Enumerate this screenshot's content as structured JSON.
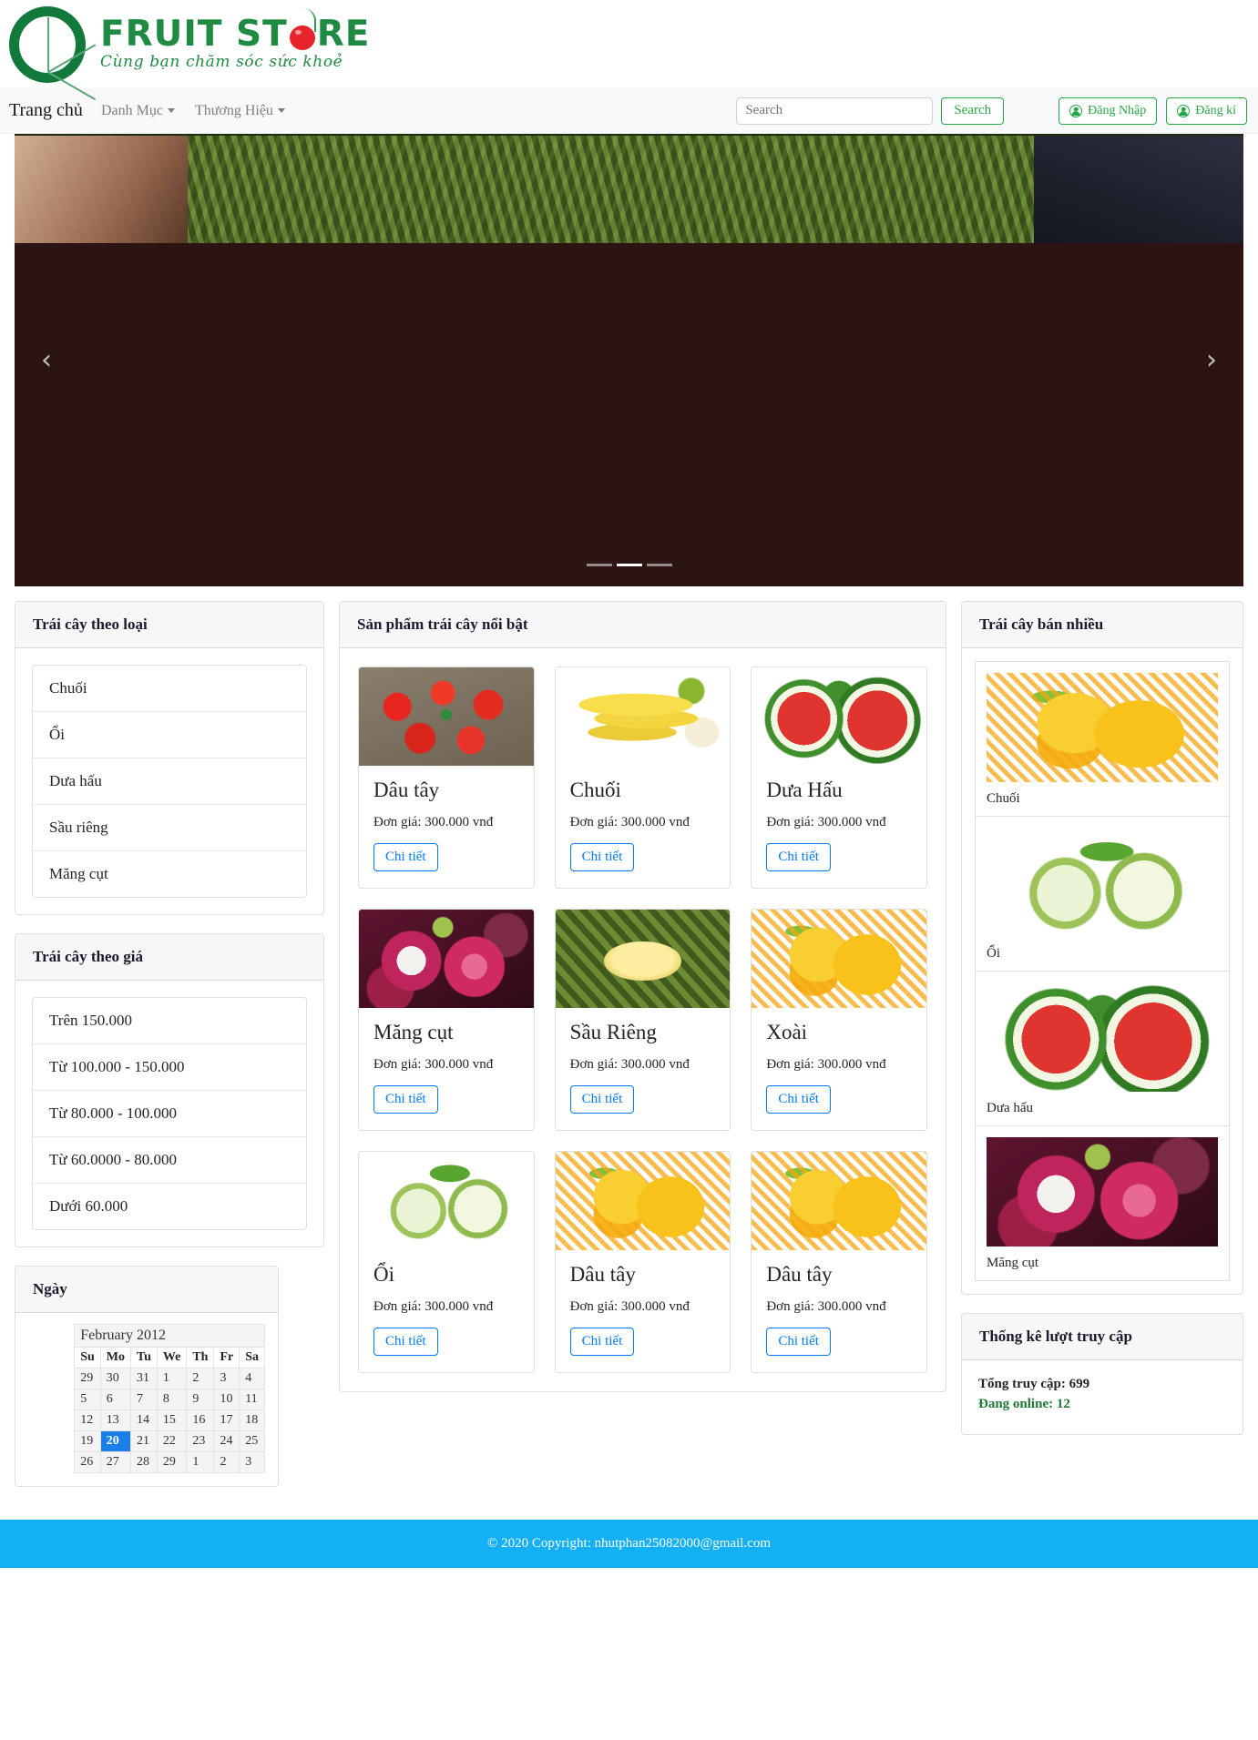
{
  "brand": {
    "name_part1": "FRUIT ST",
    "name_part2": "RE",
    "tagline": "Cùng bạn chăm sóc sức khoẻ"
  },
  "nav": {
    "home": "Trang chủ",
    "items": [
      {
        "label": "Danh Mục",
        "icon": "chevron-down-icon"
      },
      {
        "label": "Thương Hiệu",
        "icon": "chevron-down-icon"
      }
    ],
    "search": {
      "placeholder": "Search",
      "value": "",
      "button": "Search"
    },
    "login": "Đăng Nhập",
    "register": "Đăng kí"
  },
  "carousel": {
    "prev": "‹",
    "next": "›",
    "slides": 3,
    "active_index": 1
  },
  "categories": {
    "title": "Trái cây theo loại",
    "items": [
      "Chuối",
      "Ổi",
      "Dưa hấu",
      "Sầu riêng",
      "Măng cụt"
    ]
  },
  "prices": {
    "title": "Trái cây theo giá",
    "items": [
      "Trên 150.000",
      "Từ 100.000 - 150.000",
      "Từ 80.000 - 100.000",
      "Từ 60.0000 - 80.000",
      "Dưới 60.000"
    ]
  },
  "calendar": {
    "title": "Ngày",
    "month_label": "February 2012",
    "weekdays": [
      "Su",
      "Mo",
      "Tu",
      "We",
      "Th",
      "Fr",
      "Sa"
    ],
    "weeks": [
      [
        "29",
        "30",
        "31",
        "1",
        "2",
        "3",
        "4"
      ],
      [
        "5",
        "6",
        "7",
        "8",
        "9",
        "10",
        "11"
      ],
      [
        "12",
        "13",
        "14",
        "15",
        "16",
        "17",
        "18"
      ],
      [
        "19",
        "20",
        "21",
        "22",
        "23",
        "24",
        "25"
      ],
      [
        "26",
        "27",
        "28",
        "29",
        "1",
        "2",
        "3"
      ]
    ],
    "selected_day": "20"
  },
  "featured": {
    "title": "Sản phẩm trái cây nổi bật",
    "detail_label": "Chi tiết",
    "products": [
      {
        "name": "Dâu tây",
        "price": "Đơn giá: 300.000 vnđ",
        "image": "strawberry"
      },
      {
        "name": "Chuối",
        "price": "Đơn giá: 300.000 vnđ",
        "image": "banana"
      },
      {
        "name": "Dưa Hấu",
        "price": "Đơn giá: 300.000 vnđ",
        "image": "watermelon"
      },
      {
        "name": "Măng cụt",
        "price": "Đơn giá: 300.000 vnđ",
        "image": "mangosteen"
      },
      {
        "name": "Sầu Riêng",
        "price": "Đơn giá: 300.000 vnđ",
        "image": "durian"
      },
      {
        "name": "Xoài",
        "price": "Đơn giá: 300.000 vnđ",
        "image": "mango"
      },
      {
        "name": "Ổi",
        "price": "Đơn giá: 300.000 vnđ",
        "image": "guava"
      },
      {
        "name": "Dâu tây",
        "price": "Đơn giá: 300.000 vnđ",
        "image": "mango"
      },
      {
        "name": "Dâu tây",
        "price": "Đơn giá: 300.000 vnđ",
        "image": "mango"
      }
    ]
  },
  "bestsellers": {
    "title": "Trái cây bán nhiều",
    "items": [
      {
        "name": "Chuối",
        "image": "mango"
      },
      {
        "name": "Ổi",
        "image": "guava"
      },
      {
        "name": "Dưa hấu",
        "image": "watermelon"
      },
      {
        "name": "Măng cụt",
        "image": "mangosteen"
      }
    ]
  },
  "stats": {
    "title": "Thống kê lượt truy cập",
    "total": "Tổng truy cập: 699",
    "online": "Đang online: 12"
  },
  "footer": {
    "copyright": "© 2020 Copyright: nhutphan25082000@gmail.com"
  },
  "colors": {
    "brand_green": "#1f8a42",
    "accent_blue": "#007bff",
    "footer_blue": "#13b0f5",
    "today_blue": "#1a7fe8",
    "online_green": "#1f7a34"
  }
}
